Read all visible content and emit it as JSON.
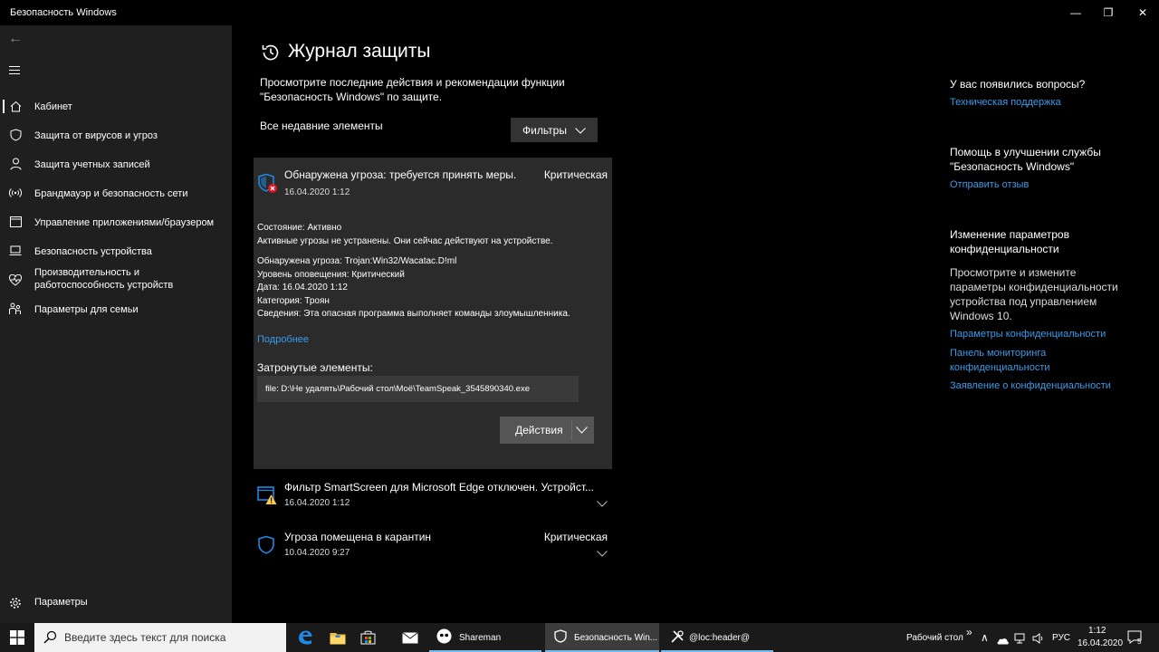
{
  "window": {
    "title": "Безопасность Windows",
    "minimize_glyph": "—",
    "restore_glyph": "❐",
    "close_glyph": "✕"
  },
  "sidebar": {
    "back_glyph": "←",
    "items": [
      {
        "label": "Кабинет",
        "icon": "home-icon",
        "active": true
      },
      {
        "label": "Защита от вирусов и угроз",
        "icon": "shield-icon"
      },
      {
        "label": "Защита учетных записей",
        "icon": "person-icon"
      },
      {
        "label": "Брандмауэр и безопасность сети",
        "icon": "wifi-signal-icon"
      },
      {
        "label": "Управление приложениями/браузером",
        "icon": "app-window-icon"
      },
      {
        "label": "Безопасность устройства",
        "icon": "laptop-icon"
      },
      {
        "label": "Производительность и работоспособность устройств",
        "icon": "heart-icon"
      },
      {
        "label": "Параметры для семьи",
        "icon": "family-icon"
      }
    ],
    "settings_label": "Параметры"
  },
  "main": {
    "title": "Журнал защиты",
    "subtitle": "Просмотрите последние действия и рекомендации функции \"Безопасность Windows\" по защите.",
    "section_label": "Все недавние элементы",
    "filters_label": "Фильтры",
    "expanded_item": {
      "title": "Обнаружена угроза: требуется принять меры.",
      "date": "16.04.2020 1:12",
      "severity": "Критическая",
      "state_line1": "Состояние:  Активно",
      "state_line2": "Активные угрозы не устранены. Они сейчас действуют на устройстве.",
      "details": [
        "Обнаружена угроза:  Trojan:Win32/Wacatac.D!ml",
        "Уровень оповещения: Критический",
        "Дата: 16.04.2020 1:12",
        "Категория:  Троян",
        "Сведения:  Эта опасная программа выполняет команды злоумышленника."
      ],
      "more_link": "Подробнее",
      "affected_label": "Затронутые элементы:",
      "affected_file": "file: D:\\Не удалять\\Рабочий стол\\Моё\\TeamSpeak_3545890340.exe",
      "actions_label": "Действия"
    },
    "items": [
      {
        "title": "Фильтр SmartScreen для Microsoft Edge отключен. Устройст...",
        "date": "16.04.2020 1:12",
        "severity": ""
      },
      {
        "title": "Угроза помещена в карантин",
        "date": "10.04.2020 9:27",
        "severity": "Критическая"
      }
    ]
  },
  "right": {
    "q_title": "У вас появились вопросы?",
    "q_link": "Техническая поддержка",
    "improve_title": "Помощь в улучшении службы \"Безопасность Windows\"",
    "improve_link": "Отправить отзыв",
    "privacy_title": "Изменение параметров конфиденциальности",
    "privacy_desc": "Просмотрите и измените параметры конфиденциальности устройства под управлением Windows 10.",
    "privacy_links": [
      "Параметры конфиденциальности",
      "Панель мониторинга конфиденциальности",
      "Заявление о конфиденциальности"
    ]
  },
  "taskbar": {
    "search_placeholder": "Введите здесь текст для поиска",
    "apps": [
      {
        "label": "Shareman"
      },
      {
        "label": "Безопасность Win..."
      },
      {
        "label": "@loc:header@"
      }
    ],
    "desktop_label": "Рабочий стол",
    "overflow_glyph": "»",
    "chevron_glyph": "∧",
    "language": "РУС",
    "time": "1:12",
    "date": "16.04.2020",
    "notification_count": "5"
  },
  "colors": {
    "accent_link": "#3a9be8",
    "sidebar_bg": "#1f1f1f",
    "card_bg": "#2b2b2b",
    "critical_red": "#e81123",
    "warning_yellow": "#ffc83d",
    "shield_blue": "#1e88e5"
  }
}
